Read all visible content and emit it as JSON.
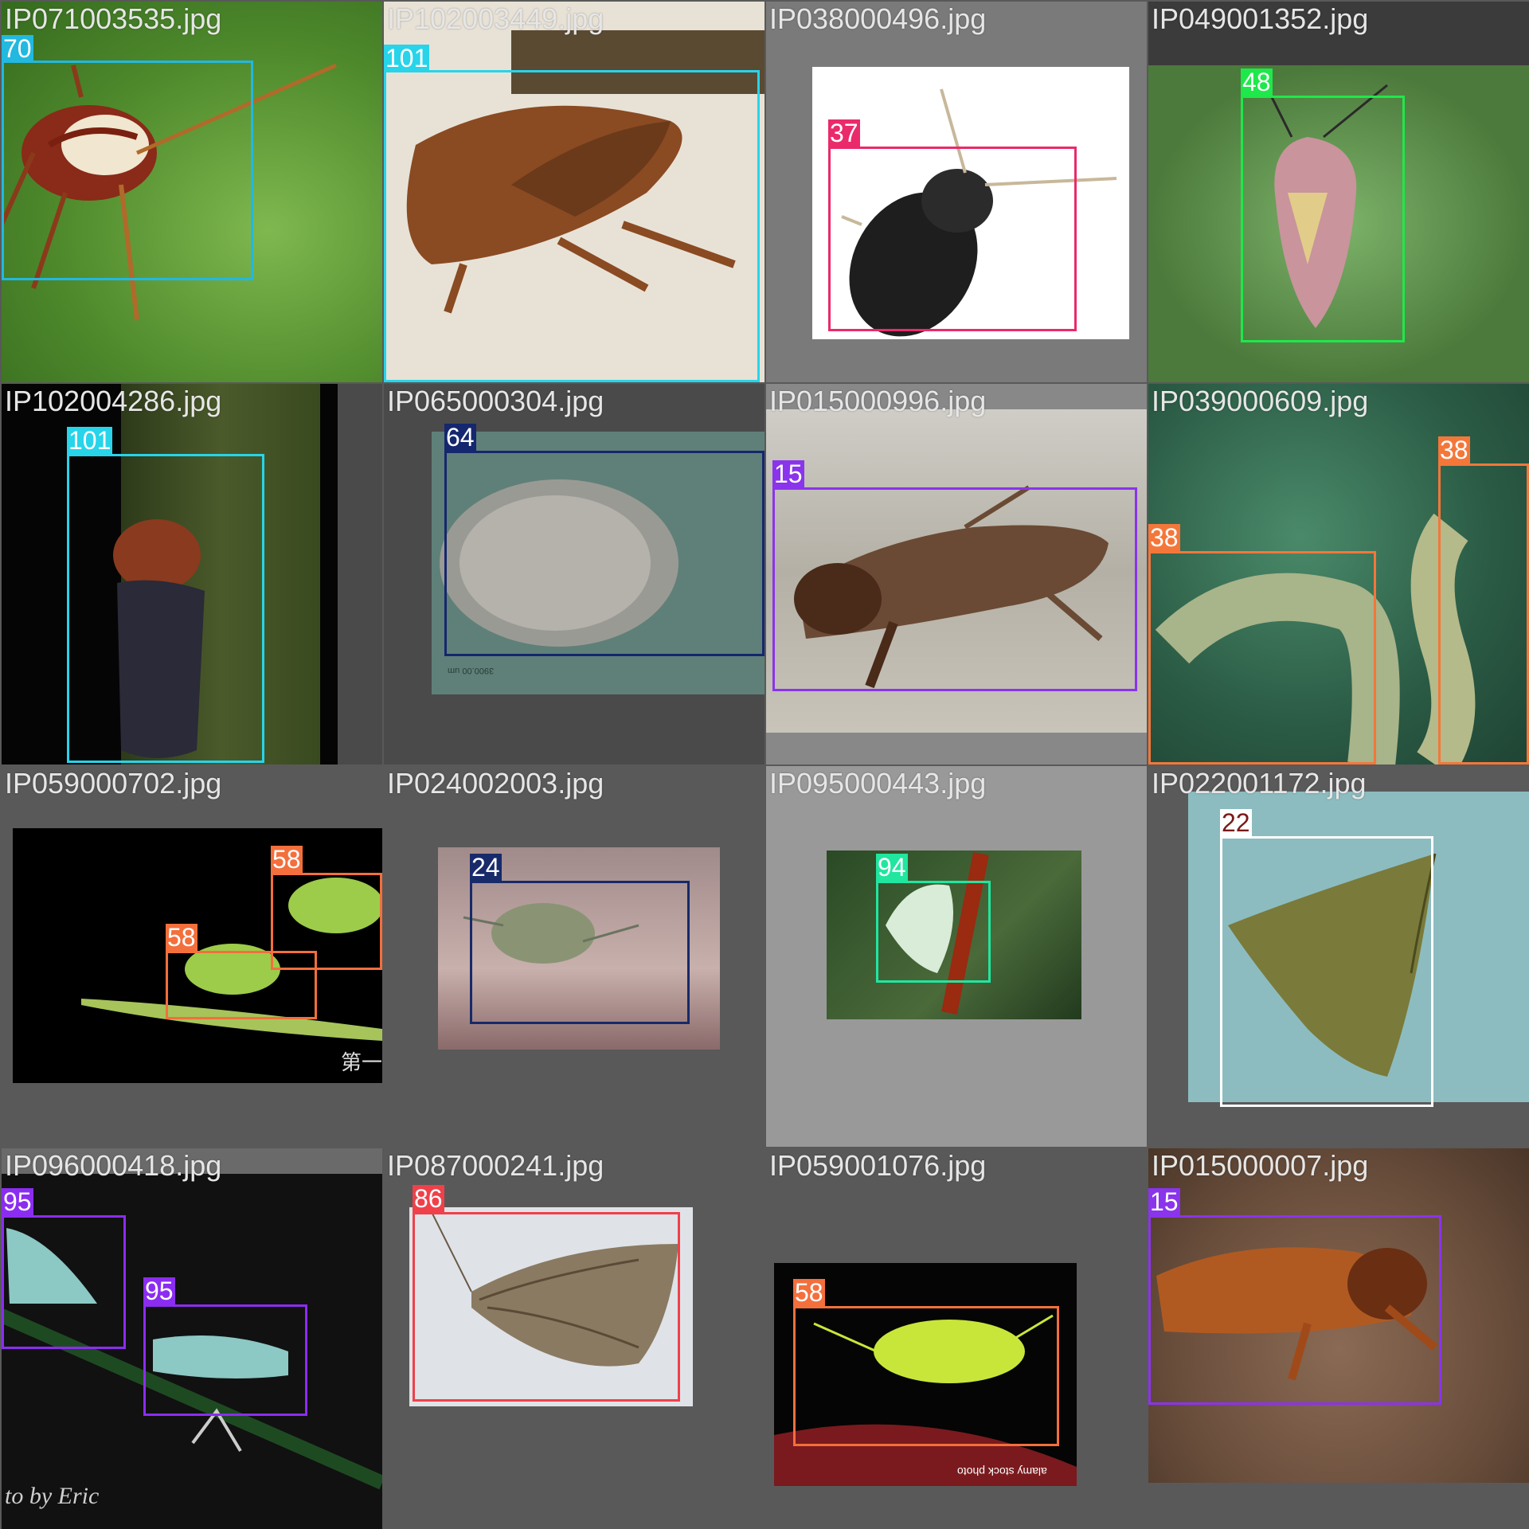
{
  "tiles": [
    {
      "file": "IP071003535.jpg",
      "labels": [
        "70"
      ],
      "colors": [
        "#22b8e0"
      ]
    },
    {
      "file": "IP102003449.jpg",
      "labels": [
        "101"
      ],
      "colors": [
        "#27d4ea"
      ]
    },
    {
      "file": "IP038000496.jpg",
      "labels": [
        "37"
      ],
      "colors": [
        "#ea2a6a"
      ]
    },
    {
      "file": "IP049001352.jpg",
      "labels": [
        "48"
      ],
      "colors": [
        "#1ee84a"
      ]
    },
    {
      "file": "IP102004286.jpg",
      "labels": [
        "101"
      ],
      "colors": [
        "#27d4ea"
      ]
    },
    {
      "file": "IP065000304.jpg",
      "labels": [
        "64"
      ],
      "colors": [
        "#15276e"
      ]
    },
    {
      "file": "IP015000996.jpg",
      "labels": [
        "15"
      ],
      "colors": [
        "#8a34ec"
      ]
    },
    {
      "file": "IP039000609.jpg",
      "labels": [
        "38",
        "38"
      ],
      "colors": [
        "#f4773a",
        "#f4773a"
      ]
    },
    {
      "file": "IP059000702.jpg",
      "labels": [
        "58",
        "58"
      ],
      "colors": [
        "#f36f3c",
        "#f36f3c"
      ]
    },
    {
      "file": "IP024002003.jpg",
      "labels": [
        "24"
      ],
      "colors": [
        "#172a6a"
      ]
    },
    {
      "file": "IP095000443.jpg",
      "labels": [
        "94"
      ],
      "colors": [
        "#20e6a0"
      ]
    },
    {
      "file": "IP022001172.jpg",
      "labels": [
        "22"
      ],
      "colors": [
        "#ffffff"
      ]
    },
    {
      "file": "IP096000418.jpg",
      "labels": [
        "95",
        "95"
      ],
      "colors": [
        "#8b2df0",
        "#8b2df0"
      ]
    },
    {
      "file": "IP087000241.jpg",
      "labels": [
        "86"
      ],
      "colors": [
        "#f0404a"
      ]
    },
    {
      "file": "IP059001076.jpg",
      "labels": [
        "58"
      ],
      "colors": [
        "#f36f3c"
      ]
    },
    {
      "file": "IP015000007.jpg",
      "labels": [
        "15"
      ],
      "colors": [
        "#8a34ec"
      ]
    }
  ],
  "watermarks": {
    "scale_bar": "3900.00 um",
    "chinese": "第一",
    "alamy": "alamy stock photo",
    "signature": "to by Eric"
  }
}
